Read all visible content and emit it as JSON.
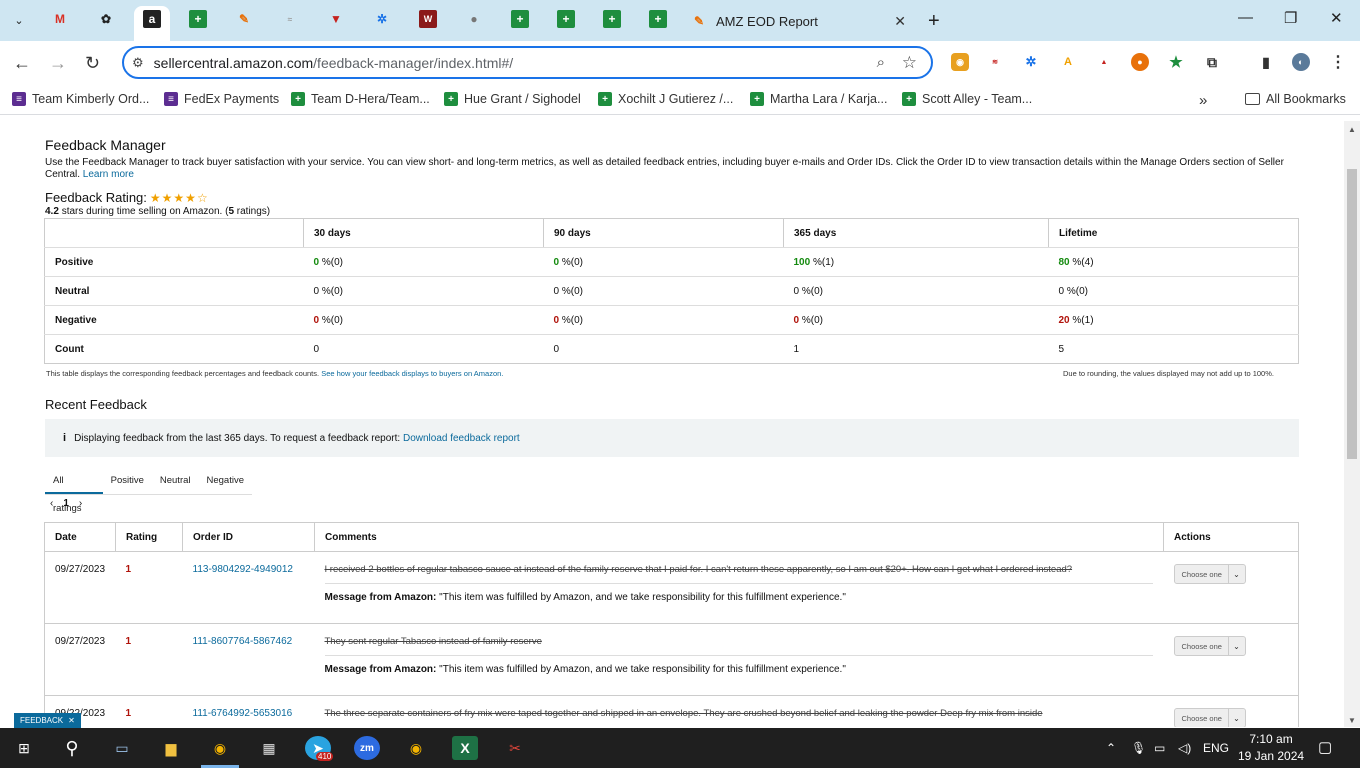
{
  "browser": {
    "active_tab_title": "AMZ EOD Report",
    "url_host": "sellercentral.amazon.com",
    "url_path": "/feedback-manager/index.html#/",
    "bookmarks": [
      {
        "label": "Team Kimberly Ord...",
        "icon": "list-icon",
        "color": "#5c2d91"
      },
      {
        "label": "FedEx Payments",
        "icon": "list-icon",
        "color": "#5c2d91"
      },
      {
        "label": "Team D-Hera/Team...",
        "icon": "sheets-icon",
        "color": "#1e8e3e"
      },
      {
        "label": "Hue Grant / Sighodel",
        "icon": "sheets-icon",
        "color": "#1e8e3e"
      },
      {
        "label": "Xochilt J Gutierez /...",
        "icon": "sheets-icon",
        "color": "#1e8e3e"
      },
      {
        "label": "Martha Lara / Karja...",
        "icon": "sheets-icon",
        "color": "#1e8e3e"
      },
      {
        "label": "Scott Alley - Team...",
        "icon": "sheets-icon",
        "color": "#1e8e3e"
      }
    ],
    "more_bookmarks": "»",
    "all_bookmarks": "All Bookmarks"
  },
  "feedback_manager": {
    "title": "Feedback Manager",
    "description": "Use the Feedback Manager to track buyer satisfaction with your service. You can view short- and long-term metrics, as well as detailed feedback entries, including buyer e-mails and Order IDs. Click the Order ID to view transaction details within the Manage Orders section of Seller Central.",
    "learn_more": "Learn more",
    "rating_label": "Feedback Rating:",
    "stars_filled": 4,
    "stars_total": 5,
    "rating_value": "4.2",
    "rating_text": "stars during time selling on Amazon.",
    "rating_count": "5",
    "rating_count_label": "ratings"
  },
  "metrics": {
    "headers": [
      "30 days",
      "90 days",
      "365 days",
      "Lifetime"
    ],
    "rows": [
      {
        "label": "Positive",
        "cells": [
          {
            "v": "0",
            "c": "(0)"
          },
          {
            "v": "0",
            "c": "(0)"
          },
          {
            "v": "100",
            "c": "(1)"
          },
          {
            "v": "80",
            "c": "(4)"
          }
        ]
      },
      {
        "label": "Neutral",
        "cells": [
          {
            "v": "0",
            "c": "(0)"
          },
          {
            "v": "0",
            "c": "(0)"
          },
          {
            "v": "0",
            "c": "(0)"
          },
          {
            "v": "0",
            "c": "(0)"
          }
        ]
      },
      {
        "label": "Negative",
        "cells": [
          {
            "v": "0",
            "c": "(0)"
          },
          {
            "v": "0",
            "c": "(0)"
          },
          {
            "v": "0",
            "c": "(0)"
          },
          {
            "v": "20",
            "c": "(1)"
          }
        ]
      },
      {
        "label": "Count",
        "cells": [
          {
            "v": "0"
          },
          {
            "v": "0"
          },
          {
            "v": "1"
          },
          {
            "v": "5"
          }
        ]
      }
    ],
    "footnote_left": "This table displays the corresponding feedback percentages and feedback counts.",
    "footnote_link": "See how your feedback displays to buyers on Amazon.",
    "footnote_right": "Due to rounding, the values displayed may not add up to 100%."
  },
  "recent": {
    "title": "Recent Feedback",
    "info_text": "Displaying feedback from the last 365 days. To request a feedback report:",
    "info_link": "Download feedback report",
    "tabs": [
      "All ratings",
      "Positive",
      "Neutral",
      "Negative"
    ],
    "page": "1",
    "columns": [
      "Date",
      "Rating",
      "Order ID",
      "Comments",
      "Actions"
    ],
    "message_label": "Message from Amazon:",
    "message_text": "\"This item was fulfilled by Amazon, and we take responsibility for this fulfillment experience.\"",
    "action_placeholder": "Choose one",
    "rows": [
      {
        "date": "09/27/2023",
        "rating": "1",
        "order_id": "113-9804292-4949012",
        "comment": "I received 2 bottles of regular tabasco sauce at instead of the family reserve that I paid for. I can't return these apparently, so I am out $20+. How can I get what I ordered instead?"
      },
      {
        "date": "09/27/2023",
        "rating": "1",
        "order_id": "111-8607764-5867462",
        "comment": "They sent regular Tabasco instead of family reserve"
      },
      {
        "date": "09/22/2023",
        "rating": "1",
        "order_id": "111-6764992-5653016",
        "comment": "The three separate containers of fry mix were taped together and shipped in an envelope. They are crushed beyond belief and leaking the powder Deep fry mix from inside"
      }
    ]
  },
  "feedback_badge": "FEEDBACK",
  "taskbar": {
    "time": "7:10 am",
    "date": "19 Jan 2024",
    "lang": "ENG",
    "telegram_badge": "410"
  }
}
